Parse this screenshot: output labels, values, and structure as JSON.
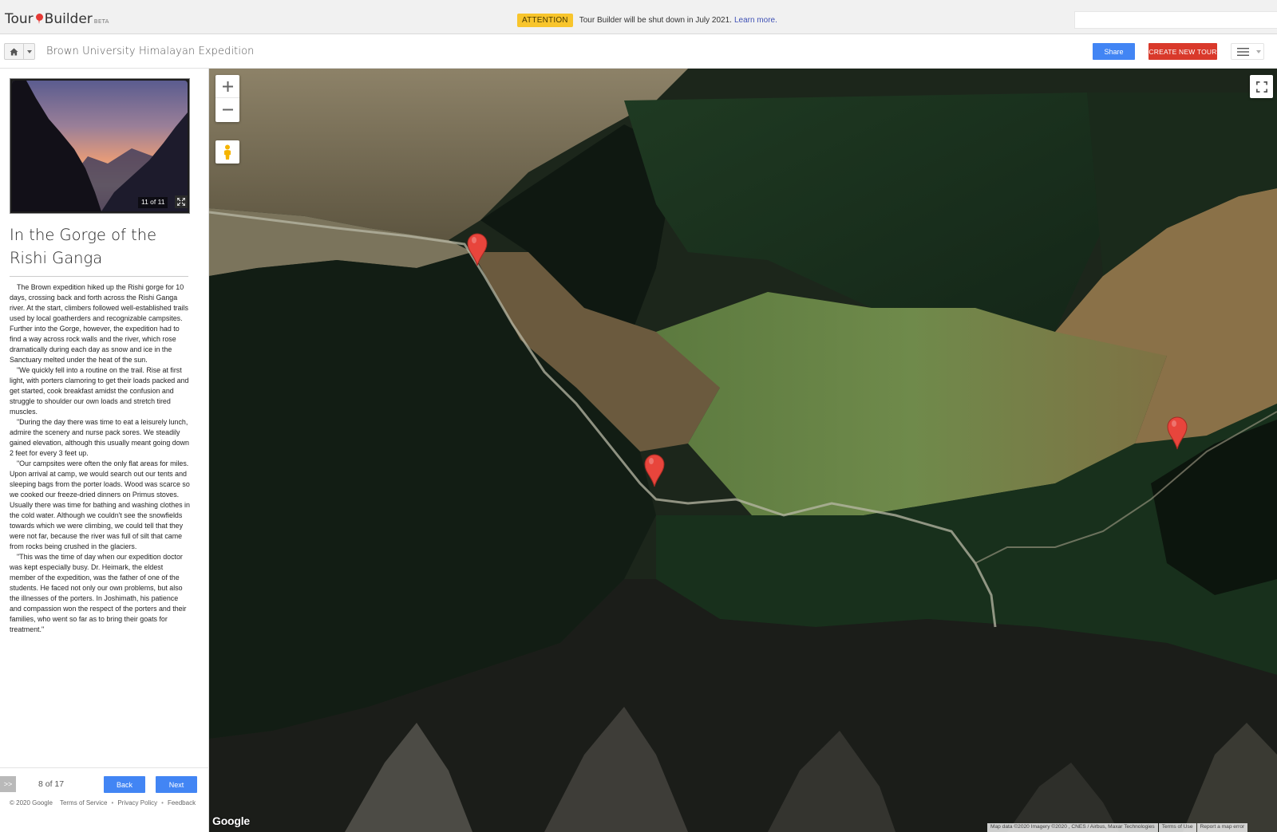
{
  "app": {
    "logo_word1": "Tour",
    "logo_word2": "Builder",
    "logo_beta": "BETA"
  },
  "announcement": {
    "badge": "ATTENTION",
    "message": "Tour Builder will be shut down in July 2021.",
    "link": "Learn more."
  },
  "toolbar": {
    "tour_title": "Brown University Himalayan Expedition",
    "share_label": "Share",
    "create_label": "CREATE NEW TOUR"
  },
  "slideshow": {
    "counter": "11 of 11"
  },
  "stop": {
    "title": "In the Gorge of the Rishi Ganga",
    "paragraphs": [
      "The Brown expedition hiked up the Rishi gorge for 10 days, crossing back and forth across the Rishi Ganga river.  At the start, climbers followed well-established trails used by local goatherders and recognizable campsites.  Further into the Gorge, however, the expedition had to find a way across rock walls and the river, which rose dramatically during each day as snow and ice in the Sanctuary melted under the heat of the sun.",
      "\"We quickly fell into a routine on the trail.  Rise at first light, with porters clamoring to get their loads packed and get started, cook breakfast amidst the confusion and struggle to shoulder our own loads and stretch tired muscles.",
      "\"During the day there was time to eat a leisurely lunch, admire the scenery and nurse pack sores.  We steadily gained elevation, although this usually meant going down 2 feet for every 3 feet up.",
      "\"Our campsites were often the only flat areas for miles.  Upon arrival at camp, we would search out our tents and sleeping bags from the porter loads.  Wood was scarce so we cooked our freeze-dried dinners on Primus stoves.  Usually there was time for bathing and washing clothes in the cold water.  Although we couldn't see the snowfields towards which we were climbing, we could tell that they were not far, because the river was full of silt that came from rocks being crushed in the glaciers.",
      "\"This was the time of day when our expedition doctor was kept especially busy.  Dr. Heimark, the eldest member of the expedition, was the father of one of the students.  He faced not only our own problems, but also the illnesses of the porters.  In Joshimath, his patience and compassion won the respect of the porters and their families, who went so far as to bring their goats for treatment.\""
    ]
  },
  "navigation": {
    "expand_label": ">>",
    "page_count": "8 of 17",
    "back_label": "Back",
    "next_label": "Next"
  },
  "legal": {
    "copyright": "© 2020 Google",
    "terms": "Terms of Service",
    "privacy": "Privacy Policy",
    "feedback": "Feedback",
    "separator": "•"
  },
  "map": {
    "google_logo": "Google",
    "attribution": "Map data ©2020 Imagery ©2020 , CNES / Airbus, Maxar Technologies",
    "terms": "Terms of Use",
    "report": "Report a map error",
    "marker_color": "#e8453c"
  },
  "icons": {
    "home": "home-icon",
    "menu": "hamburger-menu-icon",
    "zoom_in": "plus-icon",
    "zoom_out": "minus-icon",
    "street_view": "pegman-icon",
    "fullscreen": "fullscreen-icon",
    "marker": "map-pin-icon"
  },
  "colors": {
    "share_button": "#4285f4",
    "create_button": "#d9392b",
    "nav_buttons": "#4285f4",
    "attention_badge": "#f8c52c",
    "link": "#3f51b5"
  }
}
